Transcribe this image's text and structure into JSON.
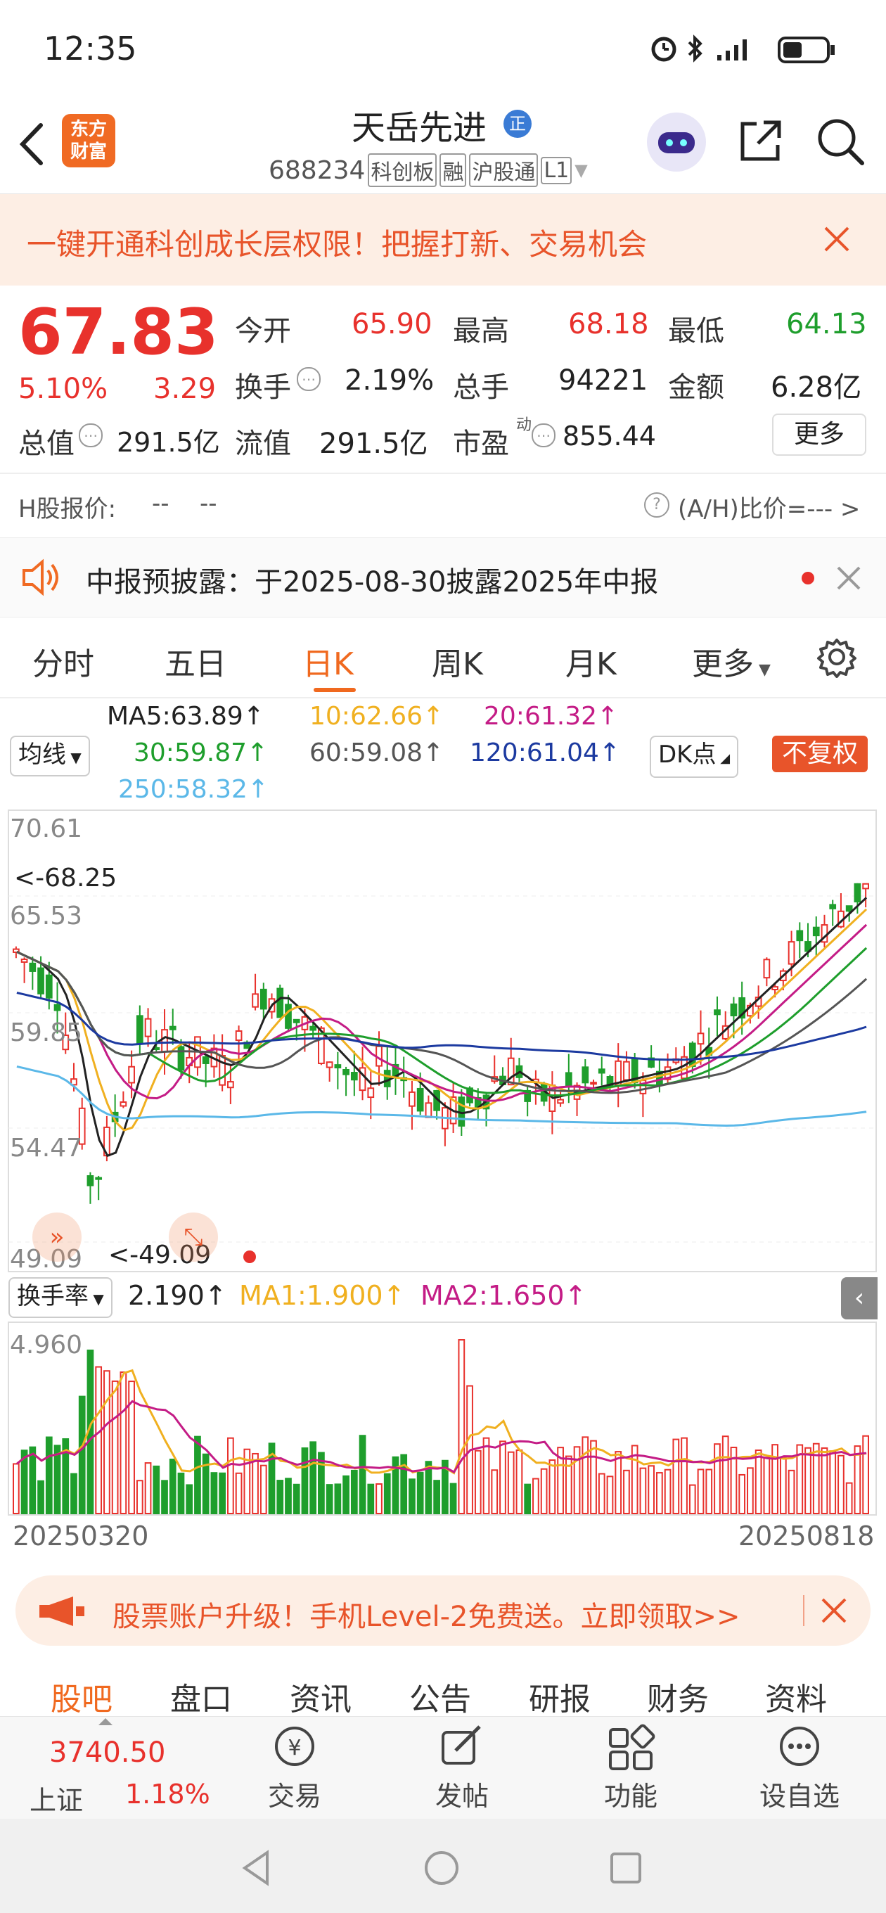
{
  "status_bar": {
    "time": "12:35"
  },
  "header": {
    "logo_text_1": "东方",
    "logo_text_2": "财富",
    "stock_name": "天岳先进",
    "badge": "正",
    "code_line": "688234",
    "tag_1": "科创板",
    "tag_2": "融",
    "tag_3": "沪股通",
    "tag_4": "L1"
  },
  "banner": {
    "text": "一键开通科创成长层权限！把握打新、交易机会"
  },
  "quote": {
    "price": "67.83",
    "change_pct": "5.10%",
    "change": "3.29",
    "open_label": "今开",
    "open": "65.90",
    "high_label": "最高",
    "high": "68.18",
    "low_label": "最低",
    "low": "64.13",
    "turnover_label": "换手",
    "turnover": "2.19%",
    "volume_label": "总手",
    "volume": "94221",
    "amount_label": "金额",
    "amount": "6.28亿",
    "mktcap_label": "总值",
    "mktcap": "291.5亿",
    "float_label": "流值",
    "float_cap": "291.5亿",
    "pe_label": "市盈",
    "pe_sup": "动",
    "pe": "855.44",
    "more_button": "更多",
    "h_label": "H股报价:",
    "h_value": "--",
    "h_value2": "--",
    "ah_label": "(A/H)比价=---  >"
  },
  "notice": {
    "text": "中报预披露：于2025-08-30披露2025年中报"
  },
  "tabs": [
    "分时",
    "五日",
    "日K",
    "周K",
    "月K",
    "更多"
  ],
  "active_tab": 2,
  "ma_lines": {
    "ma5": "MA5:63.89↑",
    "ma10": "10:62.66↑",
    "ma20": "20:61.32↑",
    "ma30": "30:59.87↑",
    "ma60": "60:59.08↑",
    "ma120": "120:61.04↑",
    "ma250": "250:58.32↑",
    "selector": "均线",
    "dk_button": "DK点",
    "adjust_button": "不复权"
  },
  "kchart": {
    "y_labels": [
      "70.61",
      "65.53",
      "59.85",
      "54.47",
      "49.09"
    ],
    "max_marker": "<-68.25",
    "min_marker": "<-49.09"
  },
  "volume_panel": {
    "selector": "换手率",
    "value": "2.190↑",
    "ma1": "MA1:1.900↑",
    "ma2": "MA2:1.650↑",
    "y_max": "4.960",
    "date_start": "20250320",
    "date_end": "20250818"
  },
  "promo": {
    "text": "股票账户升级！手机Level-2免费送。立即领取>>"
  },
  "bottom_tabs": [
    "股吧",
    "盘口",
    "资讯",
    "公告",
    "研报",
    "财务",
    "资料"
  ],
  "index_info": {
    "value": "3740.50",
    "name": "上证",
    "pct": "1.18%"
  },
  "bottom_nav": [
    "交易",
    "发帖",
    "功能",
    "设自选"
  ],
  "colors": {
    "up": "#e8312c",
    "down": "#1e9e2c",
    "accent": "#f0691f"
  }
}
